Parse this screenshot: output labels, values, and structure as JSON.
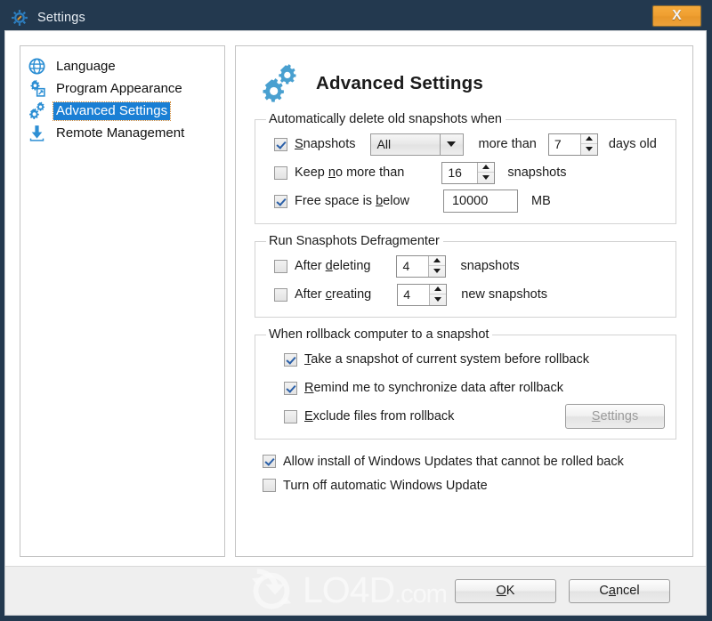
{
  "window": {
    "title": "Settings",
    "title_icon": "gear-icon",
    "close_label": "X",
    "frame_color": "#23394f",
    "accent_color": "#1a7fd4",
    "close_button_color": "#f0a032"
  },
  "sidebar": {
    "items": [
      {
        "label": "Language",
        "icon": "globe-icon",
        "selected": false
      },
      {
        "label": "Program Appearance",
        "icon": "gears-window-icon",
        "selected": false
      },
      {
        "label": "Advanced Settings",
        "icon": "gears-icon",
        "selected": true
      },
      {
        "label": "Remote Management",
        "icon": "download-arrow-icon",
        "selected": false
      }
    ]
  },
  "page": {
    "title": "Advanced Settings",
    "icon": "gears-icon"
  },
  "groups": {
    "auto_delete": {
      "legend": "Automatically delete old snapshots when",
      "snapshots": {
        "label_pre": "S",
        "label_post": "napshots",
        "checked": true,
        "dropdown_value": "All",
        "dropdown_options": [
          "All"
        ],
        "mid_label": "more than",
        "days_value": "7",
        "days_label": "days old"
      },
      "keep_no_more": {
        "label_a": "Keep ",
        "label_acc": "n",
        "label_b": "o more than",
        "checked": false,
        "value": "16",
        "unit": "snapshots"
      },
      "free_space": {
        "label_a": "Free space is ",
        "label_acc": "b",
        "label_b": "elow",
        "checked": true,
        "value": "10000",
        "unit": "MB"
      }
    },
    "defragmenter": {
      "legend": "Run Snasphots Defragmenter",
      "after_deleting": {
        "label_a": "After ",
        "label_acc": "d",
        "label_b": "eleting",
        "checked": false,
        "value": "4",
        "unit": "snapshots"
      },
      "after_creating": {
        "label_a": "After ",
        "label_acc": "c",
        "label_b": "reating",
        "checked": false,
        "value": "4",
        "unit": "new snapshots"
      }
    },
    "rollback": {
      "legend": "When rollback computer to a snapshot",
      "take_snapshot": {
        "label_acc": "T",
        "label_b": "ake a snapshot of current system before rollback",
        "checked": true
      },
      "remind_sync": {
        "label_acc": "R",
        "label_b": "emind me to synchronize data after rollback",
        "checked": true
      },
      "exclude_files": {
        "label_acc": "E",
        "label_b": "xclude files from rollback",
        "checked": false
      },
      "settings_button": {
        "label_acc": "S",
        "label_b": "ettings",
        "disabled": true
      }
    }
  },
  "loose_options": {
    "allow_updates": {
      "label": "Allow install of Windows Updates that cannot be rolled back",
      "checked": true
    },
    "turn_off_update": {
      "label": "Turn off automatic Windows Update",
      "checked": false
    }
  },
  "footer": {
    "ok": {
      "acc": "O",
      "rest": "K"
    },
    "cancel": {
      "a": "C",
      "acc": "a",
      "b": "ncel"
    }
  },
  "watermark": {
    "text": "LO4D",
    "suffix": ".com",
    "logo": "refresh-circle-icon"
  }
}
